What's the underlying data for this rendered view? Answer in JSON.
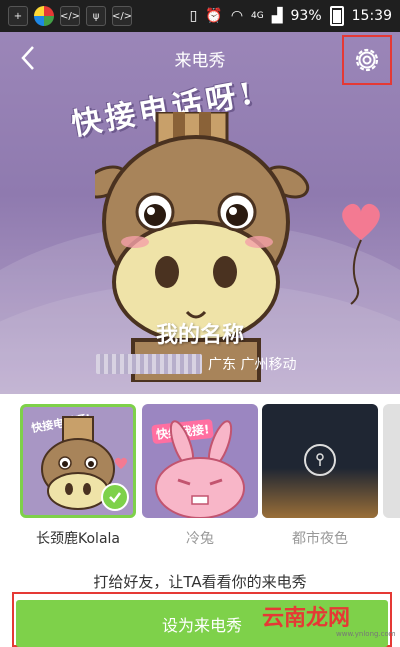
{
  "status_bar": {
    "battery": "93%",
    "time": "15:39",
    "network": "4G",
    "icons": [
      "add-icon",
      "app-icon",
      "code-icon",
      "usb-icon",
      "code-icon",
      "vibrate-icon",
      "alarm-icon",
      "wifi-icon",
      "signal-icon",
      "battery-icon"
    ]
  },
  "header": {
    "title": "来电秀"
  },
  "preview": {
    "slogan": "快接电话呀!",
    "caller_name": "我的名称",
    "caller_location": "广东 广州移动"
  },
  "themes": [
    {
      "label": "长颈鹿Kolala",
      "selected": true,
      "tag": "快接电话呀!"
    },
    {
      "label": "冷兔",
      "selected": false,
      "tag": "快给我接!"
    },
    {
      "label": "都市夜色",
      "selected": false
    }
  ],
  "footer": {
    "hint": "打给好友，让TA看看你的来电秀",
    "set_button": "设为来电秀",
    "watermark": "云南龙网",
    "watermark_sub": "www.ynlong.com"
  },
  "colors": {
    "accent": "#7ed14a",
    "hero_bg": "#9b86b8",
    "highlight": "#e53935"
  }
}
